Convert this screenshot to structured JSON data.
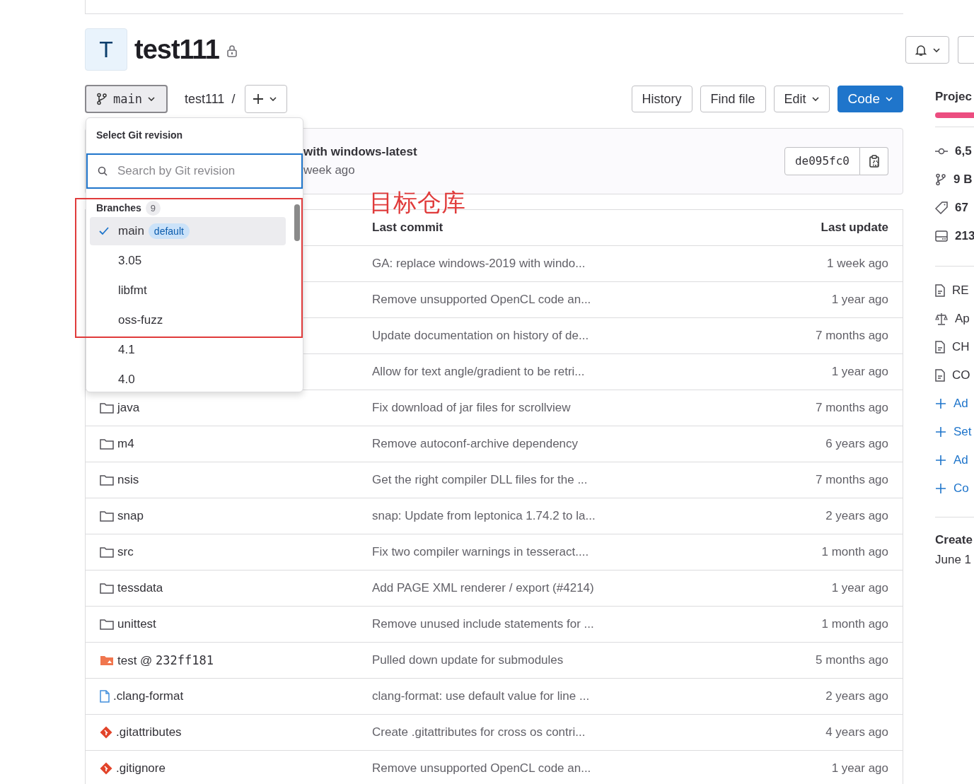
{
  "project": {
    "avatar_letter": "T",
    "title": "test111",
    "private": true
  },
  "toolbar": {
    "branch": "main",
    "path": "test111",
    "separator": "/",
    "buttons": [
      "History",
      "Find file",
      "Edit",
      "Code"
    ]
  },
  "last_commit": {
    "title": "with windows-latest",
    "time": "week ago",
    "sha": "de095fc0"
  },
  "revision_dropdown": {
    "title": "Select Git revision",
    "search": {
      "placeholder": "Search by Git revision"
    },
    "section": "Branches",
    "count": "9",
    "items": [
      {
        "label": "main",
        "badge": "default",
        "selected": true
      },
      {
        "label": "3.05",
        "selected": false
      },
      {
        "label": "libfmt",
        "selected": false
      },
      {
        "label": "oss-fuzz",
        "selected": false
      },
      {
        "label": "4.1",
        "selected": false
      },
      {
        "label": "4.0",
        "selected": false
      }
    ]
  },
  "annotation": {
    "text": "目标仓库"
  },
  "table": {
    "columns": [
      "Last commit",
      "Last update"
    ],
    "rows": [
      {
        "commit": "GA: replace windows-2019 with windo...",
        "updated": "1 week ago"
      },
      {
        "commit": "Remove unsupported OpenCL code an...",
        "updated": "1 year ago"
      },
      {
        "commit": "Update documentation on history of de...",
        "updated": "7 months ago"
      },
      {
        "commit": "Allow for text angle/gradient to be retri...",
        "updated": "1 year ago"
      },
      {
        "kind": "folder",
        "name": "java",
        "commit": "Fix download of jar files for scrollview",
        "updated": "7 months ago"
      },
      {
        "kind": "folder",
        "name": "m4",
        "commit": "Remove autoconf-archive dependency",
        "updated": "6 years ago"
      },
      {
        "kind": "folder",
        "name": "nsis",
        "commit": "Get the right compiler DLL files for the ...",
        "updated": "7 months ago"
      },
      {
        "kind": "folder",
        "name": "snap",
        "commit": "snap: Update from leptonica 1.74.2 to la...",
        "updated": "2 years ago"
      },
      {
        "kind": "folder",
        "name": "src",
        "commit": "Fix two compiler warnings in tesseract....",
        "updated": "1 month ago"
      },
      {
        "kind": "folder",
        "name": "tessdata",
        "commit": "Add PAGE XML renderer / export (#4214)",
        "updated": "1 year ago"
      },
      {
        "kind": "folder",
        "name": "unittest",
        "commit": "Remove unused include statements for ...",
        "updated": "1 month ago"
      },
      {
        "kind": "submodule",
        "name": "test @ ",
        "ref": "232ff181",
        "commit": "Pulled down update for submodules",
        "updated": "5 months ago"
      },
      {
        "kind": "file",
        "name": ".clang-format",
        "commit": "clang-format: use default value for line ...",
        "updated": "2 years ago"
      },
      {
        "kind": "git",
        "name": ".gitattributes",
        "commit": "Create .gitattributes for cross os contri...",
        "updated": "4 years ago"
      },
      {
        "kind": "git",
        "name": ".gitignore",
        "commit": "Remove unsupported OpenCL code an...",
        "updated": "1 year ago"
      }
    ]
  },
  "sidebar": {
    "heading": "Projec",
    "stats": [
      {
        "kind": "commit",
        "text": "6,5"
      },
      {
        "kind": "branch",
        "text": "9 B"
      },
      {
        "kind": "tag",
        "text": "67"
      },
      {
        "kind": "storage",
        "text": "213"
      }
    ],
    "links": [
      {
        "kind": "doc",
        "text": "RE"
      },
      {
        "kind": "license",
        "text": "Ap"
      },
      {
        "kind": "doc",
        "text": "CH"
      },
      {
        "kind": "doc",
        "text": "CO"
      },
      {
        "kind": "add",
        "text": "Ad"
      },
      {
        "kind": "add",
        "text": "Set"
      },
      {
        "kind": "add",
        "text": "Ad"
      },
      {
        "kind": "add",
        "text": "Co"
      }
    ],
    "created_label": "Create",
    "created_date": "June 1"
  }
}
